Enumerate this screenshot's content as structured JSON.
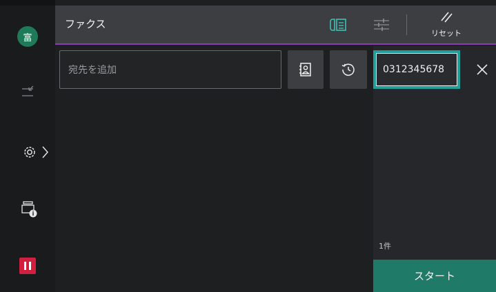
{
  "header": {
    "title": "ファクス",
    "reset_label": "リセット"
  },
  "sidebar": {
    "avatar_text": "富"
  },
  "recipient": {
    "placeholder": "宛先を追加"
  },
  "destination": {
    "number": "0312345678",
    "count": "1件"
  },
  "actions": {
    "start_label": "スタート"
  },
  "icons": {
    "sidebar": [
      "swap-icon",
      "settings-icon",
      "chevron-right-icon",
      "device-info-icon",
      "stop-icon"
    ],
    "header": [
      "fax-doc-icon",
      "adjust-icon",
      "reset-icon"
    ],
    "toolbar": [
      "address-book-icon",
      "history-icon",
      "close-icon"
    ]
  },
  "colors": {
    "accent_line": "#8b3db8",
    "selection": "#1f9e9a",
    "start": "#1f7a68",
    "stop": "#d1203f",
    "avatar": "#1f7a5a"
  }
}
